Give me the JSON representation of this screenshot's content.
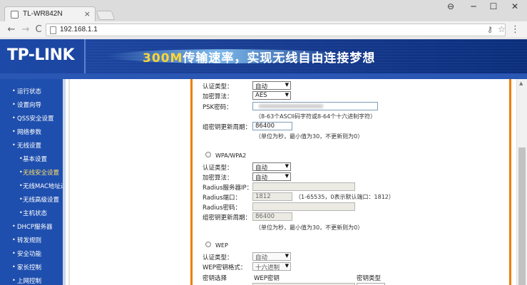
{
  "browser": {
    "tab_title": "TL-WR842N",
    "tab_close": "×",
    "url": "192.168.1.1",
    "controls": {
      "profile": "⊖",
      "minimize": "─",
      "maximize": "☐",
      "close": "✕"
    },
    "nav": {
      "back": "←",
      "forward": "→",
      "reload": "C",
      "key": "⚷",
      "star": "☆",
      "menu": "⋮"
    }
  },
  "banner": {
    "logo": "TP-LINK",
    "slogan_accent": "300M",
    "slogan_rest": "传输速率，实现无线自由连接梦想"
  },
  "sidebar": {
    "items": [
      {
        "label": "运行状态",
        "sub": false
      },
      {
        "label": "设置向导",
        "sub": false
      },
      {
        "label": "QSS安全设置",
        "sub": false
      },
      {
        "label": "网络参数",
        "sub": false
      },
      {
        "label": "无线设置",
        "sub": false
      },
      {
        "label": "基本设置",
        "sub": true
      },
      {
        "label": "无线安全设置",
        "sub": true,
        "active": true
      },
      {
        "label": "无线MAC地址过滤",
        "sub": true
      },
      {
        "label": "无线高级设置",
        "sub": true
      },
      {
        "label": "主机状态",
        "sub": true
      },
      {
        "label": "DHCP服务器",
        "sub": false
      },
      {
        "label": "转发规则",
        "sub": false
      },
      {
        "label": "安全功能",
        "sub": false
      },
      {
        "label": "家长控制",
        "sub": false
      },
      {
        "label": "上网控制",
        "sub": false
      }
    ]
  },
  "wpa_psk": {
    "auth_type_label": "认证类型：",
    "auth_type_value": "自动",
    "cipher_label": "加密算法：",
    "cipher_value": "AES",
    "psk_label": "PSK密码：",
    "psk_hint": "（8-63个ASCII码字符或8-64个十六进制字符）",
    "rekey_label": "组密钥更新周期：",
    "rekey_value": "86400",
    "rekey_hint": "（单位为秒，最小值为30，不更新则为0）"
  },
  "wpa": {
    "title": "WPA/WPA2",
    "auth_type_label": "认证类型：",
    "auth_type_value": "自动",
    "cipher_label": "加密算法：",
    "cipher_value": "自动",
    "radius_ip_label": "Radius服务器IP：",
    "radius_port_label": "Radius端口：",
    "radius_port_value": "1812",
    "radius_port_hint": "（1-65535，0表示默认端口：1812）",
    "radius_pwd_label": "Radius密码：",
    "rekey_label": "组密钥更新周期：",
    "rekey_value": "86400",
    "rekey_hint": "（单位为秒，最小值为30，不更新则为0）"
  },
  "wep": {
    "title": "WEP",
    "auth_type_label": "认证类型：",
    "auth_type_value": "自动",
    "key_format_label": "WEP密钥格式：",
    "key_format_value": "十六进制",
    "key_select_label": "密钥选择",
    "wep_key_header": "WEP密钥",
    "key_type_header": "密钥类型"
  },
  "icons": {
    "dropdown": "▼",
    "bullet": "•",
    "scroll_up": "▲"
  },
  "colors": {
    "sidebar_bg": "#1f4fae",
    "panel_border": "#f07d00",
    "banner_accent": "#ffd633"
  }
}
